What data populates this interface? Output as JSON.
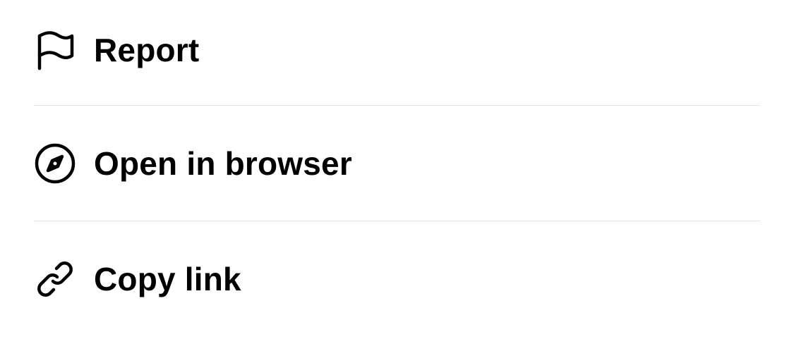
{
  "menu": {
    "items": [
      {
        "label": "Report",
        "icon": "flag-icon"
      },
      {
        "label": "Open in browser",
        "icon": "compass-icon"
      },
      {
        "label": "Copy link",
        "icon": "link-icon"
      }
    ]
  },
  "colors": {
    "background": "#ffffff",
    "text": "#000000",
    "divider": "#e3e3e3"
  }
}
